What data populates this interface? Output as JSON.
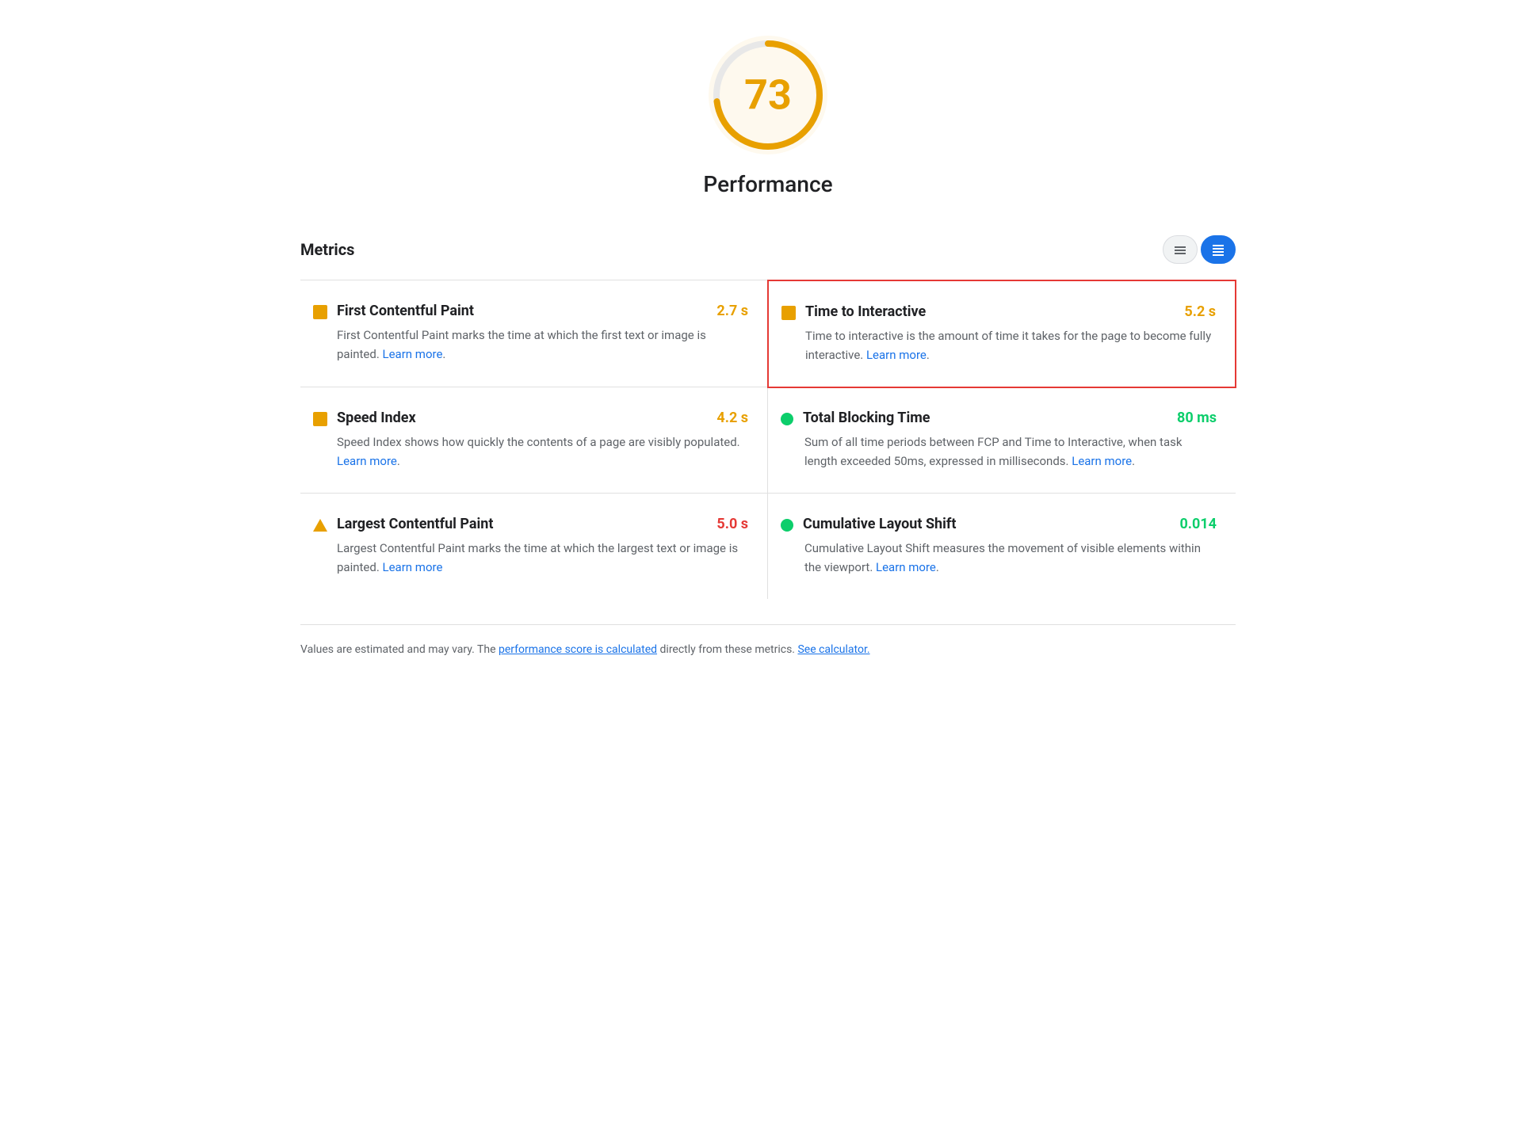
{
  "score": {
    "value": "73",
    "label": "Performance",
    "color": "#e8a000",
    "bg_color": "#fef9ee"
  },
  "metrics_section": {
    "title": "Metrics",
    "controls": {
      "list_icon": "≡",
      "detail_icon": "☰"
    }
  },
  "metrics": [
    {
      "id": "fcp",
      "title": "First Contentful Paint",
      "value": "2.7 s",
      "value_color": "orange",
      "icon_type": "orange-square",
      "description": "First Contentful Paint marks the time at which the first text or image is painted.",
      "learn_more_url": "#",
      "learn_more_label": "Learn more",
      "highlighted": false,
      "col": "left"
    },
    {
      "id": "tti",
      "title": "Time to Interactive",
      "value": "5.2 s",
      "value_color": "orange",
      "icon_type": "orange-square",
      "description": "Time to interactive is the amount of time it takes for the page to become fully interactive.",
      "learn_more_url": "#",
      "learn_more_label": "Learn more",
      "highlighted": true,
      "col": "right"
    },
    {
      "id": "si",
      "title": "Speed Index",
      "value": "4.2 s",
      "value_color": "orange",
      "icon_type": "orange-square",
      "description": "Speed Index shows how quickly the contents of a page are visibly populated.",
      "learn_more_url": "#",
      "learn_more_label": "Learn more",
      "highlighted": false,
      "col": "left"
    },
    {
      "id": "tbt",
      "title": "Total Blocking Time",
      "value": "80 ms",
      "value_color": "green",
      "icon_type": "green-circle",
      "description": "Sum of all time periods between FCP and Time to Interactive, when task length exceeded 50ms, expressed in milliseconds.",
      "learn_more_url": "#",
      "learn_more_label": "Learn more",
      "highlighted": false,
      "col": "right"
    },
    {
      "id": "lcp",
      "title": "Largest Contentful Paint",
      "value": "5.0 s",
      "value_color": "red",
      "icon_type": "orange-triangle",
      "description": "Largest Contentful Paint marks the time at which the largest text or image is painted.",
      "learn_more_url": "#",
      "learn_more_label": "Learn more",
      "highlighted": false,
      "col": "left"
    },
    {
      "id": "cls",
      "title": "Cumulative Layout Shift",
      "value": "0.014",
      "value_color": "green",
      "icon_type": "green-circle",
      "description": "Cumulative Layout Shift measures the movement of visible elements within the viewport.",
      "learn_more_url": "#",
      "learn_more_label": "Learn more",
      "highlighted": false,
      "col": "right"
    }
  ],
  "footer": {
    "text_before": "Values are estimated and may vary. The ",
    "link1_label": "performance score is calculated",
    "link1_url": "#",
    "text_middle": " directly from these metrics. ",
    "link2_label": "See calculator.",
    "link2_url": "#"
  }
}
